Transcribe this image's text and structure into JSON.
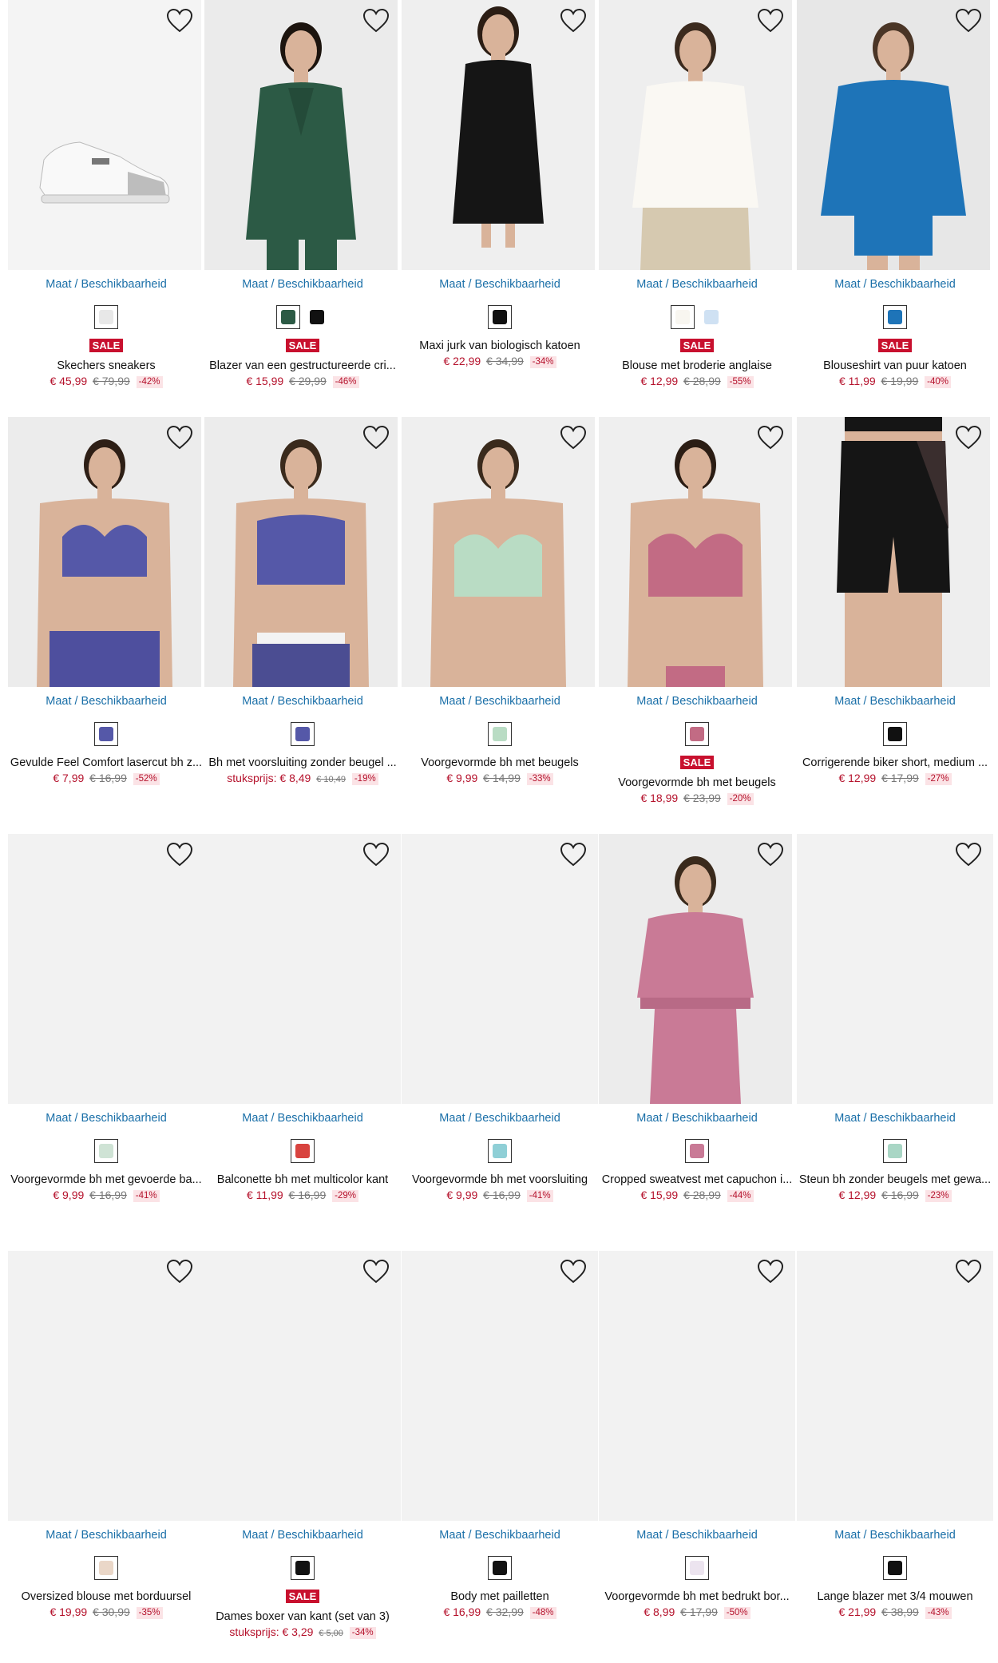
{
  "availability_label": "Maat / Beschikbaarheid",
  "colors": {
    "price": "#b5122c",
    "sale_badge": "#c8102e",
    "discount_bg": "#fbe3e6",
    "link": "#1a6fa8",
    "placeholder": "#f2f2f2"
  },
  "products": [
    {
      "title": "Skechers sneakers",
      "sale": "SALE",
      "price": "€ 45,99",
      "old_price": "€ 79,99",
      "discount": "-42%",
      "swatches": [
        "#e8e8e8"
      ],
      "image": "sneaker"
    },
    {
      "title": "Blazer van een gestructureerde cri...",
      "sale": "SALE",
      "price": "€ 15,99",
      "old_price": "€ 29,99",
      "discount": "-46%",
      "swatches": [
        "#2c5a45",
        "#111111"
      ],
      "image": "blazer-green"
    },
    {
      "title": "Maxi jurk van biologisch katoen",
      "sale": "",
      "price": "€ 22,99",
      "old_price": "€ 34,99",
      "discount": "-34%",
      "swatches": [
        "#111111"
      ],
      "image": "dress-black"
    },
    {
      "title": "Blouse met broderie anglaise",
      "sale": "SALE",
      "price": "€ 12,99",
      "old_price": "€ 28,99",
      "discount": "-55%",
      "swatches": [
        "#f8f6f0",
        "#cfe1f3"
      ],
      "image": "blouse-white"
    },
    {
      "title": "Blouseshirt van puur katoen",
      "sale": "SALE",
      "price": "€ 11,99",
      "old_price": "€ 19,99",
      "discount": "-40%",
      "swatches": [
        "#1e74b8"
      ],
      "image": "shirt-blue"
    },
    {
      "title": "Gevulde Feel Comfort lasercut bh z...",
      "sale": "",
      "price": "€ 7,99",
      "old_price": "€ 16,99",
      "discount": "-52%",
      "swatches": [
        "#5558a8"
      ],
      "image": "bra-blue"
    },
    {
      "title": "Bh met voorsluiting zonder beugel ...",
      "sale": "",
      "unit_label": "stuksprijs:",
      "price": "€ 8,49",
      "old_price": "€ 10,49",
      "discount": "-19%",
      "swatches": [
        "#5558a8"
      ],
      "image": "bra-front"
    },
    {
      "title": "Voorgevormde bh met beugels",
      "sale": "",
      "price": "€ 9,99",
      "old_price": "€ 14,99",
      "discount": "-33%",
      "swatches": [
        "#b9dcc4"
      ],
      "image": "bra-mint"
    },
    {
      "title": "Voorgevormde bh met beugels",
      "sale": "SALE",
      "price": "€ 18,99",
      "old_price": "€ 23,99",
      "discount": "-20%",
      "swatches": [
        "#c26b84"
      ],
      "image": "bra-pink"
    },
    {
      "title": "Corrigerende biker short, medium ...",
      "sale": "",
      "price": "€ 12,99",
      "old_price": "€ 17,99",
      "discount": "-27%",
      "swatches": [
        "#111111"
      ],
      "image": "biker-short"
    },
    {
      "title": "Voorgevormde bh met gevoerde ba...",
      "sale": "",
      "price": "€ 9,99",
      "old_price": "€ 16,99",
      "discount": "-41%",
      "swatches": [
        "#cfe3d5"
      ],
      "image": ""
    },
    {
      "title": "Balconette bh met multicolor kant",
      "sale": "",
      "price": "€ 11,99",
      "old_price": "€ 16,99",
      "discount": "-29%",
      "swatches": [
        "#d8433f"
      ],
      "image": ""
    },
    {
      "title": "Voorgevormde bh met voorsluiting",
      "sale": "",
      "price": "€ 9,99",
      "old_price": "€ 16,99",
      "discount": "-41%",
      "swatches": [
        "#8fcfd6"
      ],
      "image": ""
    },
    {
      "title": "Cropped sweatvest met capuchon i...",
      "sale": "",
      "price": "€ 15,99",
      "old_price": "€ 28,99",
      "discount": "-44%",
      "swatches": [
        "#c97a96"
      ],
      "image": "hoodie-pink"
    },
    {
      "title": "Steun bh zonder beugels met gewa...",
      "sale": "",
      "price": "€ 12,99",
      "old_price": "€ 16,99",
      "discount": "-23%",
      "swatches": [
        "#a9d6c5"
      ],
      "image": ""
    },
    {
      "title": "Oversized blouse met borduursel",
      "sale": "",
      "price": "€ 19,99",
      "old_price": "€ 30,99",
      "discount": "-35%",
      "swatches": [
        "#ead7c8"
      ],
      "image": ""
    },
    {
      "title": "Dames boxer van kant (set van 3)",
      "sale": "SALE",
      "unit_label": "stuksprijs:",
      "price": "€ 3,29",
      "old_price": "€ 5,00",
      "discount": "-34%",
      "swatches": [
        "#111111"
      ],
      "image": ""
    },
    {
      "title": "Body met pailletten",
      "sale": "",
      "price": "€ 16,99",
      "old_price": "€ 32,99",
      "discount": "-48%",
      "swatches": [
        "#111111"
      ],
      "image": ""
    },
    {
      "title": "Voorgevormde bh met bedrukt bor...",
      "sale": "",
      "price": "€ 8,99",
      "old_price": "€ 17,99",
      "discount": "-50%",
      "swatches": [
        "#ece4ef"
      ],
      "image": ""
    },
    {
      "title": "Lange blazer met 3/4 mouwen",
      "sale": "",
      "price": "€ 21,99",
      "old_price": "€ 38,99",
      "discount": "-43%",
      "swatches": [
        "#111111"
      ],
      "image": ""
    }
  ]
}
